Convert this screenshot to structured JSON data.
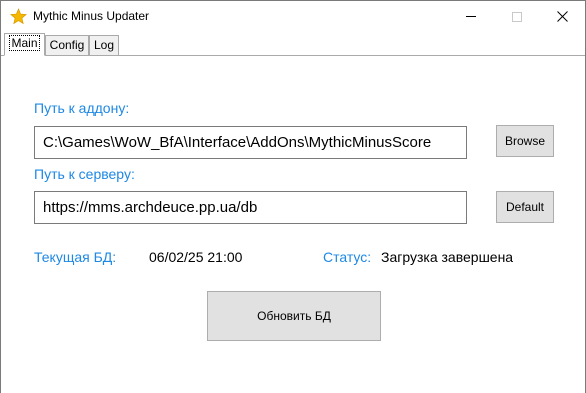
{
  "window": {
    "title": "Mythic Minus Updater",
    "icon": "star-icon"
  },
  "tabs": [
    {
      "label": "Main",
      "active": true
    },
    {
      "label": "Config",
      "active": false
    },
    {
      "label": "Log",
      "active": false
    }
  ],
  "main": {
    "addon_path_label": "Путь к аддону:",
    "addon_path_value": "C:\\Games\\WoW_BfA\\Interface\\AddOns\\MythicMinusScore",
    "browse_label": "Browse",
    "server_path_label": "Путь к серверу:",
    "server_path_value": "https://mms.archdeuce.pp.ua/db",
    "default_label": "Default",
    "current_db_label": "Текущая БД:",
    "current_db_value": "06/02/25 21:00",
    "status_label": "Статус:",
    "status_value": "Загрузка завершена",
    "update_button_label": "Обновить БД"
  },
  "colors": {
    "accent_label": "#1e88e5",
    "star": "#f5b800"
  }
}
